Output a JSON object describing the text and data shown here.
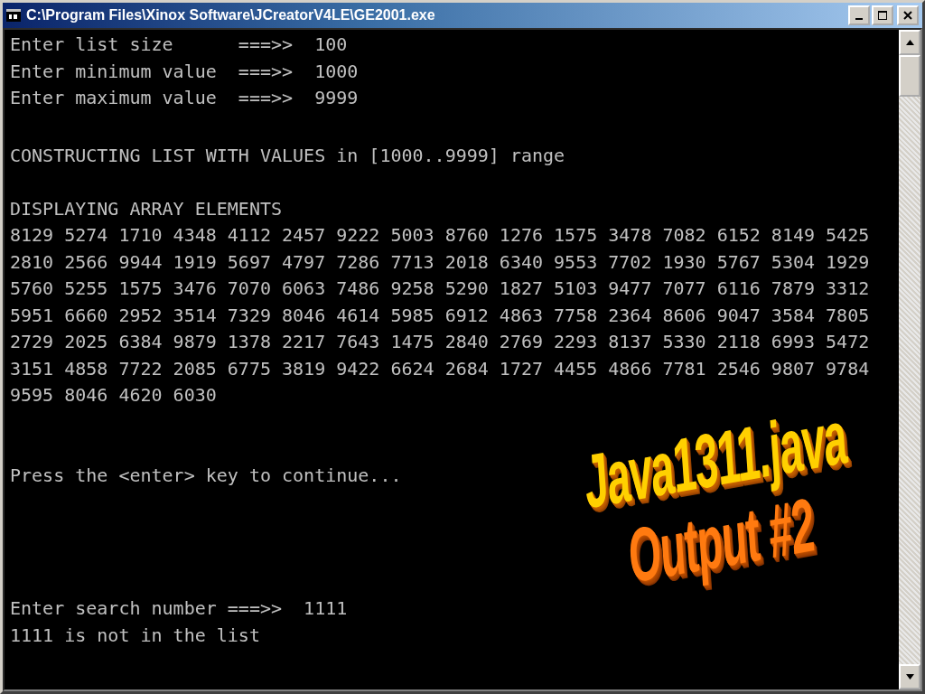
{
  "window": {
    "title": "C:\\Program Files\\Xinox Software\\JCreatorV4LE\\GE2001.exe"
  },
  "console": {
    "blocks": [
      [
        "Enter list size      ===>>  100",
        "Enter minimum value  ===>>  1000",
        "Enter maximum value  ===>>  9999"
      ],
      [
        "CONSTRUCTING LIST WITH VALUES in [1000..9999] range"
      ],
      [
        "DISPLAYING ARRAY ELEMENTS",
        "8129 5274 1710 4348 4112 2457 9222 5003 8760 1276 1575 3478 7082 6152 8149 5425",
        "2810 2566 9944 1919 5697 4797 7286 7713 2018 6340 9553 7702 1930 5767 5304 1929",
        "5760 5255 1575 3476 7070 6063 7486 9258 5290 1827 5103 9477 7077 6116 7879 3312",
        "5951 6660 2952 3514 7329 8046 4614 5985 6912 4863 7758 2364 8606 9047 3584 7805",
        "2729 2025 6384 9879 1378 2217 7643 1475 2840 2769 2293 8137 5330 2118 6993 5472",
        "3151 4858 7722 2085 6775 3819 9422 6624 2684 1727 4455 4866 7781 2546 9807 9784",
        "9595 8046 4620 6030"
      ],
      [
        "Press the <enter> key to continue..."
      ],
      [
        "Enter search number ===>>  1111",
        "1111 is not in the list"
      ]
    ]
  },
  "overlay": {
    "lines": [
      "Java1311.java",
      "Output #2"
    ]
  }
}
